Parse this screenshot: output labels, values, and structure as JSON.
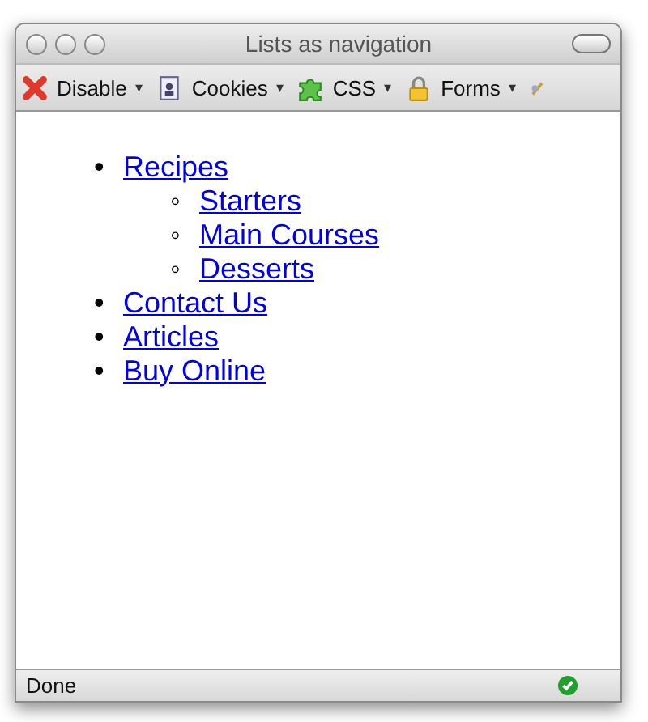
{
  "window": {
    "title": "Lists as navigation"
  },
  "toolbar": [
    {
      "kind": "disable",
      "label": "Disable",
      "caret": "▾"
    },
    {
      "kind": "cookies",
      "label": "Cookies",
      "caret": "▾"
    },
    {
      "kind": "css",
      "label": "CSS",
      "caret": "▾"
    },
    {
      "kind": "forms",
      "label": "Forms",
      "caret": "▾"
    },
    {
      "kind": "brush"
    }
  ],
  "nav": [
    {
      "marker": "•",
      "label": "Recipes",
      "children": [
        {
          "marker": "◦",
          "label": "Starters"
        },
        {
          "marker": "◦",
          "label": "Main Courses"
        },
        {
          "marker": "◦",
          "label": "Desserts"
        }
      ]
    },
    {
      "marker": "•",
      "label": "Contact Us"
    },
    {
      "marker": "•",
      "label": "Articles"
    },
    {
      "marker": "•",
      "label": "Buy Online"
    }
  ],
  "status_bar": {
    "text": "Done"
  }
}
